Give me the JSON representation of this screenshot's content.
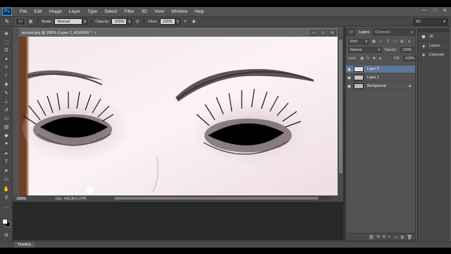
{
  "app": {
    "logo": "Ps",
    "menu": [
      "File",
      "Edit",
      "Image",
      "Layer",
      "Type",
      "Select",
      "Filter",
      "3D",
      "View",
      "Window",
      "Help"
    ],
    "window_controls": [
      "—",
      "□",
      "✕"
    ]
  },
  "options": {
    "brush_size": "13",
    "mode_label": "Mode:",
    "mode_value": "Normal",
    "opacity_label": "Opacity:",
    "opacity_value": "100%",
    "flow_label": "Flow:",
    "flow_value": "100%",
    "workspace": "3D"
  },
  "document": {
    "tab_title": "анская.jpg @ 200% (Layer 2, RGB/8#) *",
    "close": "×",
    "zoom": "200%",
    "info": "Doc: 430,3K/1,07M"
  },
  "layers_panel": {
    "tabs": [
      "3D",
      "Layers",
      "Channels"
    ],
    "kind": "Kind",
    "blend_mode": "Normal",
    "opacity_label": "Opacity:",
    "opacity_value": "100%",
    "lock_label": "Lock:",
    "fill_label": "Fill:",
    "fill_value": "100%",
    "layers": [
      {
        "name": "Layer 2",
        "selected": true
      },
      {
        "name": "Layer 1",
        "selected": false
      },
      {
        "name": "Background",
        "selected": false,
        "locked": true
      }
    ]
  },
  "dock": {
    "items": [
      "3D",
      "Layers",
      "Channels"
    ]
  },
  "timeline": {
    "label": "Timeline"
  }
}
